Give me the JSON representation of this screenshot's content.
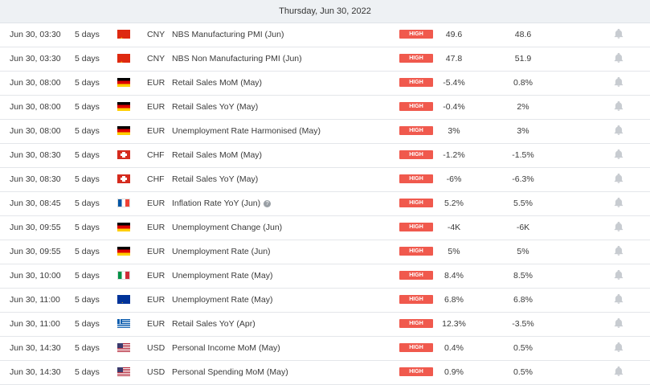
{
  "day_header": "Thursday, Jun 30, 2022",
  "importance_color": "#f0594d",
  "rows": [
    {
      "time": "Jun 30, 03:30",
      "days": "5 days",
      "flag": "cn",
      "currency": "CNY",
      "event": "NBS Manufacturing PMI (Jun)",
      "importance": "HIGH",
      "actual": "49.6",
      "forecast": "48.6",
      "info": false
    },
    {
      "time": "Jun 30, 03:30",
      "days": "5 days",
      "flag": "cn",
      "currency": "CNY",
      "event": "NBS Non Manufacturing PMI (Jun)",
      "importance": "HIGH",
      "actual": "47.8",
      "forecast": "51.9",
      "info": false
    },
    {
      "time": "Jun 30, 08:00",
      "days": "5 days",
      "flag": "de",
      "currency": "EUR",
      "event": "Retail Sales MoM (May)",
      "importance": "HIGH",
      "actual": "-5.4%",
      "forecast": "0.8%",
      "info": false
    },
    {
      "time": "Jun 30, 08:00",
      "days": "5 days",
      "flag": "de",
      "currency": "EUR",
      "event": "Retail Sales YoY (May)",
      "importance": "HIGH",
      "actual": "-0.4%",
      "forecast": "2%",
      "info": false
    },
    {
      "time": "Jun 30, 08:00",
      "days": "5 days",
      "flag": "de",
      "currency": "EUR",
      "event": "Unemployment Rate Harmonised (May)",
      "importance": "HIGH",
      "actual": "3%",
      "forecast": "3%",
      "info": false
    },
    {
      "time": "Jun 30, 08:30",
      "days": "5 days",
      "flag": "ch",
      "currency": "CHF",
      "event": "Retail Sales MoM (May)",
      "importance": "HIGH",
      "actual": "-1.2%",
      "forecast": "-1.5%",
      "info": false
    },
    {
      "time": "Jun 30, 08:30",
      "days": "5 days",
      "flag": "ch",
      "currency": "CHF",
      "event": "Retail Sales YoY (May)",
      "importance": "HIGH",
      "actual": "-6%",
      "forecast": "-6.3%",
      "info": false
    },
    {
      "time": "Jun 30, 08:45",
      "days": "5 days",
      "flag": "fr",
      "currency": "EUR",
      "event": "Inflation Rate YoY (Jun)",
      "importance": "HIGH",
      "actual": "5.2%",
      "forecast": "5.5%",
      "info": true
    },
    {
      "time": "Jun 30, 09:55",
      "days": "5 days",
      "flag": "de",
      "currency": "EUR",
      "event": "Unemployment Change (Jun)",
      "importance": "HIGH",
      "actual": "-4K",
      "forecast": "-6K",
      "info": false
    },
    {
      "time": "Jun 30, 09:55",
      "days": "5 days",
      "flag": "de",
      "currency": "EUR",
      "event": "Unemployment Rate (Jun)",
      "importance": "HIGH",
      "actual": "5%",
      "forecast": "5%",
      "info": false
    },
    {
      "time": "Jun 30, 10:00",
      "days": "5 days",
      "flag": "it",
      "currency": "EUR",
      "event": "Unemployment Rate (May)",
      "importance": "HIGH",
      "actual": "8.4%",
      "forecast": "8.5%",
      "info": false
    },
    {
      "time": "Jun 30, 11:00",
      "days": "5 days",
      "flag": "eu",
      "currency": "EUR",
      "event": "Unemployment Rate (May)",
      "importance": "HIGH",
      "actual": "6.8%",
      "forecast": "6.8%",
      "info": false
    },
    {
      "time": "Jun 30, 11:00",
      "days": "5 days",
      "flag": "gr",
      "currency": "EUR",
      "event": "Retail Sales YoY (Apr)",
      "importance": "HIGH",
      "actual": "12.3%",
      "forecast": "-3.5%",
      "info": false
    },
    {
      "time": "Jun 30, 14:30",
      "days": "5 days",
      "flag": "us",
      "currency": "USD",
      "event": "Personal Income MoM (May)",
      "importance": "HIGH",
      "actual": "0.4%",
      "forecast": "0.5%",
      "info": false
    },
    {
      "time": "Jun 30, 14:30",
      "days": "5 days",
      "flag": "us",
      "currency": "USD",
      "event": "Personal Spending MoM (May)",
      "importance": "HIGH",
      "actual": "0.9%",
      "forecast": "0.5%",
      "info": false
    }
  ]
}
